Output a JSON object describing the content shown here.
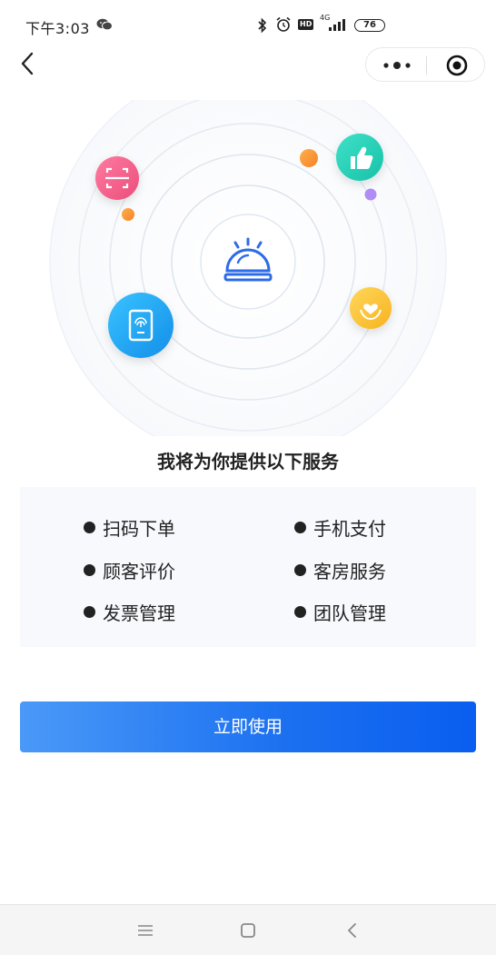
{
  "status_bar": {
    "time": "下午3:03",
    "network": "4G",
    "battery": "76"
  },
  "nav": {
    "back_icon": "chevron-left-icon",
    "more_icon": "more-dots-icon",
    "close_icon": "target-circle-icon"
  },
  "illustration": {
    "center_icon": "service-bell-icon",
    "orbit_icons": [
      "scan-icon",
      "thumbs-up-icon",
      "tablet-fingerprint-icon",
      "heart-hand-icon"
    ],
    "colors": {
      "pink": "#f0608a",
      "teal": "#26d0b8",
      "blue": "#1ea8f0",
      "yellow": "#fbc73a",
      "orange": "#f88a2a",
      "purple": "#b08cf5",
      "bell": "#2d6be8"
    }
  },
  "heading": "我将为你提供以下服务",
  "services": [
    [
      "扫码下单",
      "手机支付"
    ],
    [
      "顾客评价",
      "客房服务"
    ],
    [
      "发票管理",
      "团队管理"
    ]
  ],
  "cta": {
    "label": "立即使用",
    "color_start": "#4a99f8",
    "color_end": "#0a5ef0"
  },
  "bottom_nav": {
    "icons": [
      "menu-icon",
      "home-square-icon",
      "back-triangle-icon"
    ]
  }
}
